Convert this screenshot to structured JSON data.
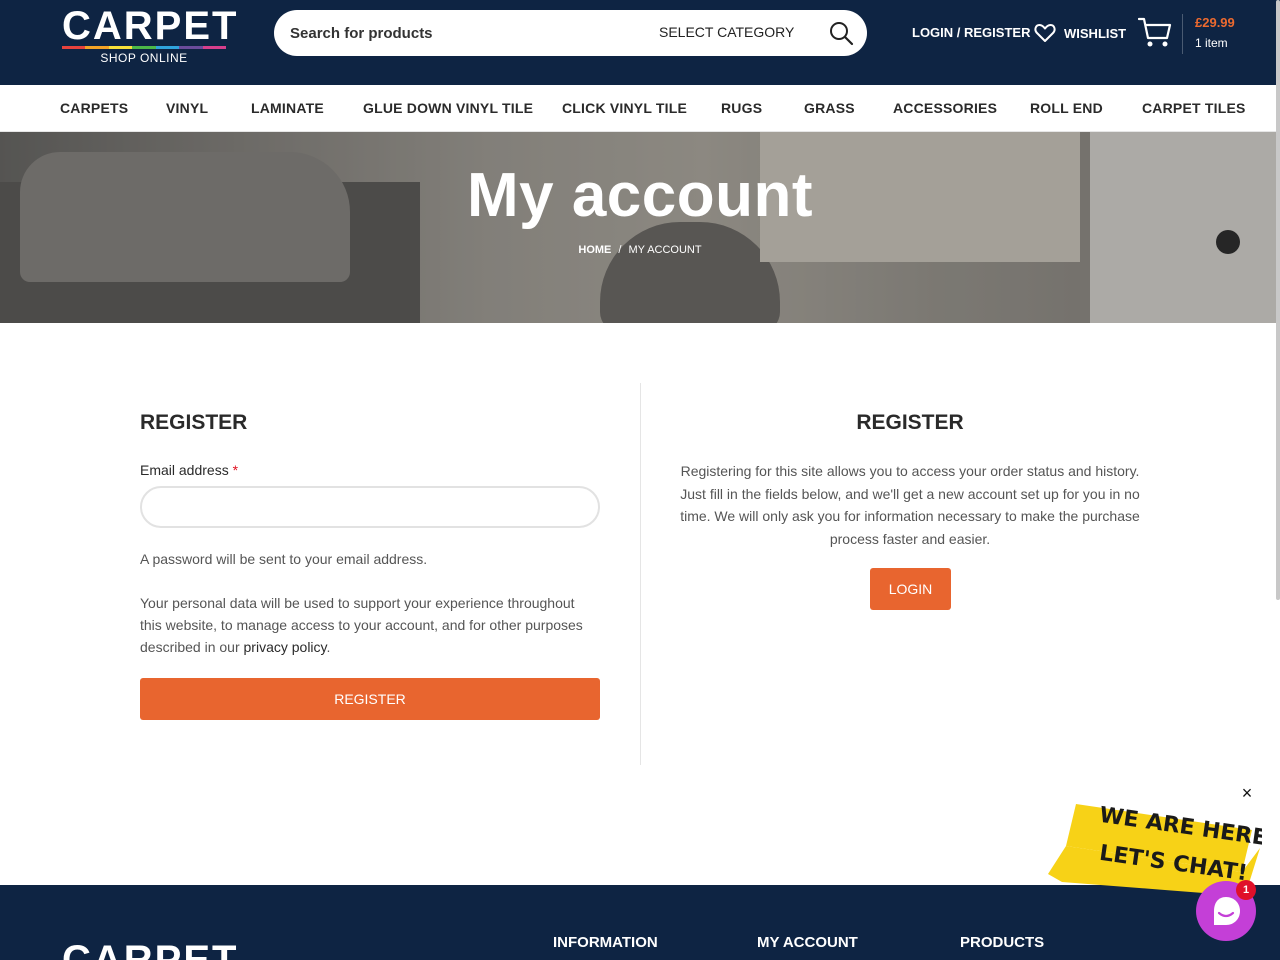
{
  "header": {
    "logo_text": "CARPET",
    "logo_subtext": "SHOP ONLINE",
    "search_placeholder": "Search for products",
    "search_category": "SELECT CATEGORY",
    "login_label": "LOGIN / REGISTER",
    "wishlist_label": "WISHLIST",
    "cart_price": "£29.99",
    "cart_count": "1 item",
    "logo_bar_colors": [
      "#e7423d",
      "#f3a326",
      "#f7e03a",
      "#4cb848",
      "#2fa3dc",
      "#6a4c9c",
      "#d63f8c"
    ]
  },
  "nav": {
    "items": [
      "CARPETS",
      "VINYL",
      "LAMINATE",
      "GLUE DOWN VINYL TILE",
      "CLICK VINYL TILE",
      "RUGS",
      "GRASS",
      "ACCESSORIES",
      "ROLL END",
      "CARPET TILES"
    ]
  },
  "hero": {
    "title": "My account",
    "breadcrumb_home": "HOME",
    "breadcrumb_sep": "/",
    "breadcrumb_current": "MY ACCOUNT"
  },
  "register_form": {
    "heading": "REGISTER",
    "email_label": "Email address",
    "required_mark": "*",
    "email_value": "",
    "password_note": "A password will be sent to your email address.",
    "privacy_text": "Your personal data will be used to support your experience throughout this website, to manage access to your account, and for other purposes described in our ",
    "privacy_link": "privacy policy",
    "privacy_end": ".",
    "button_label": "REGISTER"
  },
  "register_info": {
    "heading": "REGISTER",
    "text": "Registering for this site allows you to access your order status and history. Just fill in the fields below, and we'll get a new account set up for you in no time. We will only ask you for information necessary to make the purchase process faster and easier.",
    "login_label": "LOGIN"
  },
  "footer": {
    "logo_text": "CARPET",
    "columns": [
      "INFORMATION",
      "MY ACCOUNT",
      "PRODUCTS"
    ]
  },
  "chat": {
    "close_glyph": "×",
    "banner_line1": "WE ARE HERE!",
    "banner_line2": "LET'S CHAT!",
    "badge_count": "1"
  },
  "colors": {
    "header_bg": "#0e2443",
    "accent": "#e8652f",
    "chat": "#c43fd7",
    "banner_yellow": "#f7d217"
  }
}
